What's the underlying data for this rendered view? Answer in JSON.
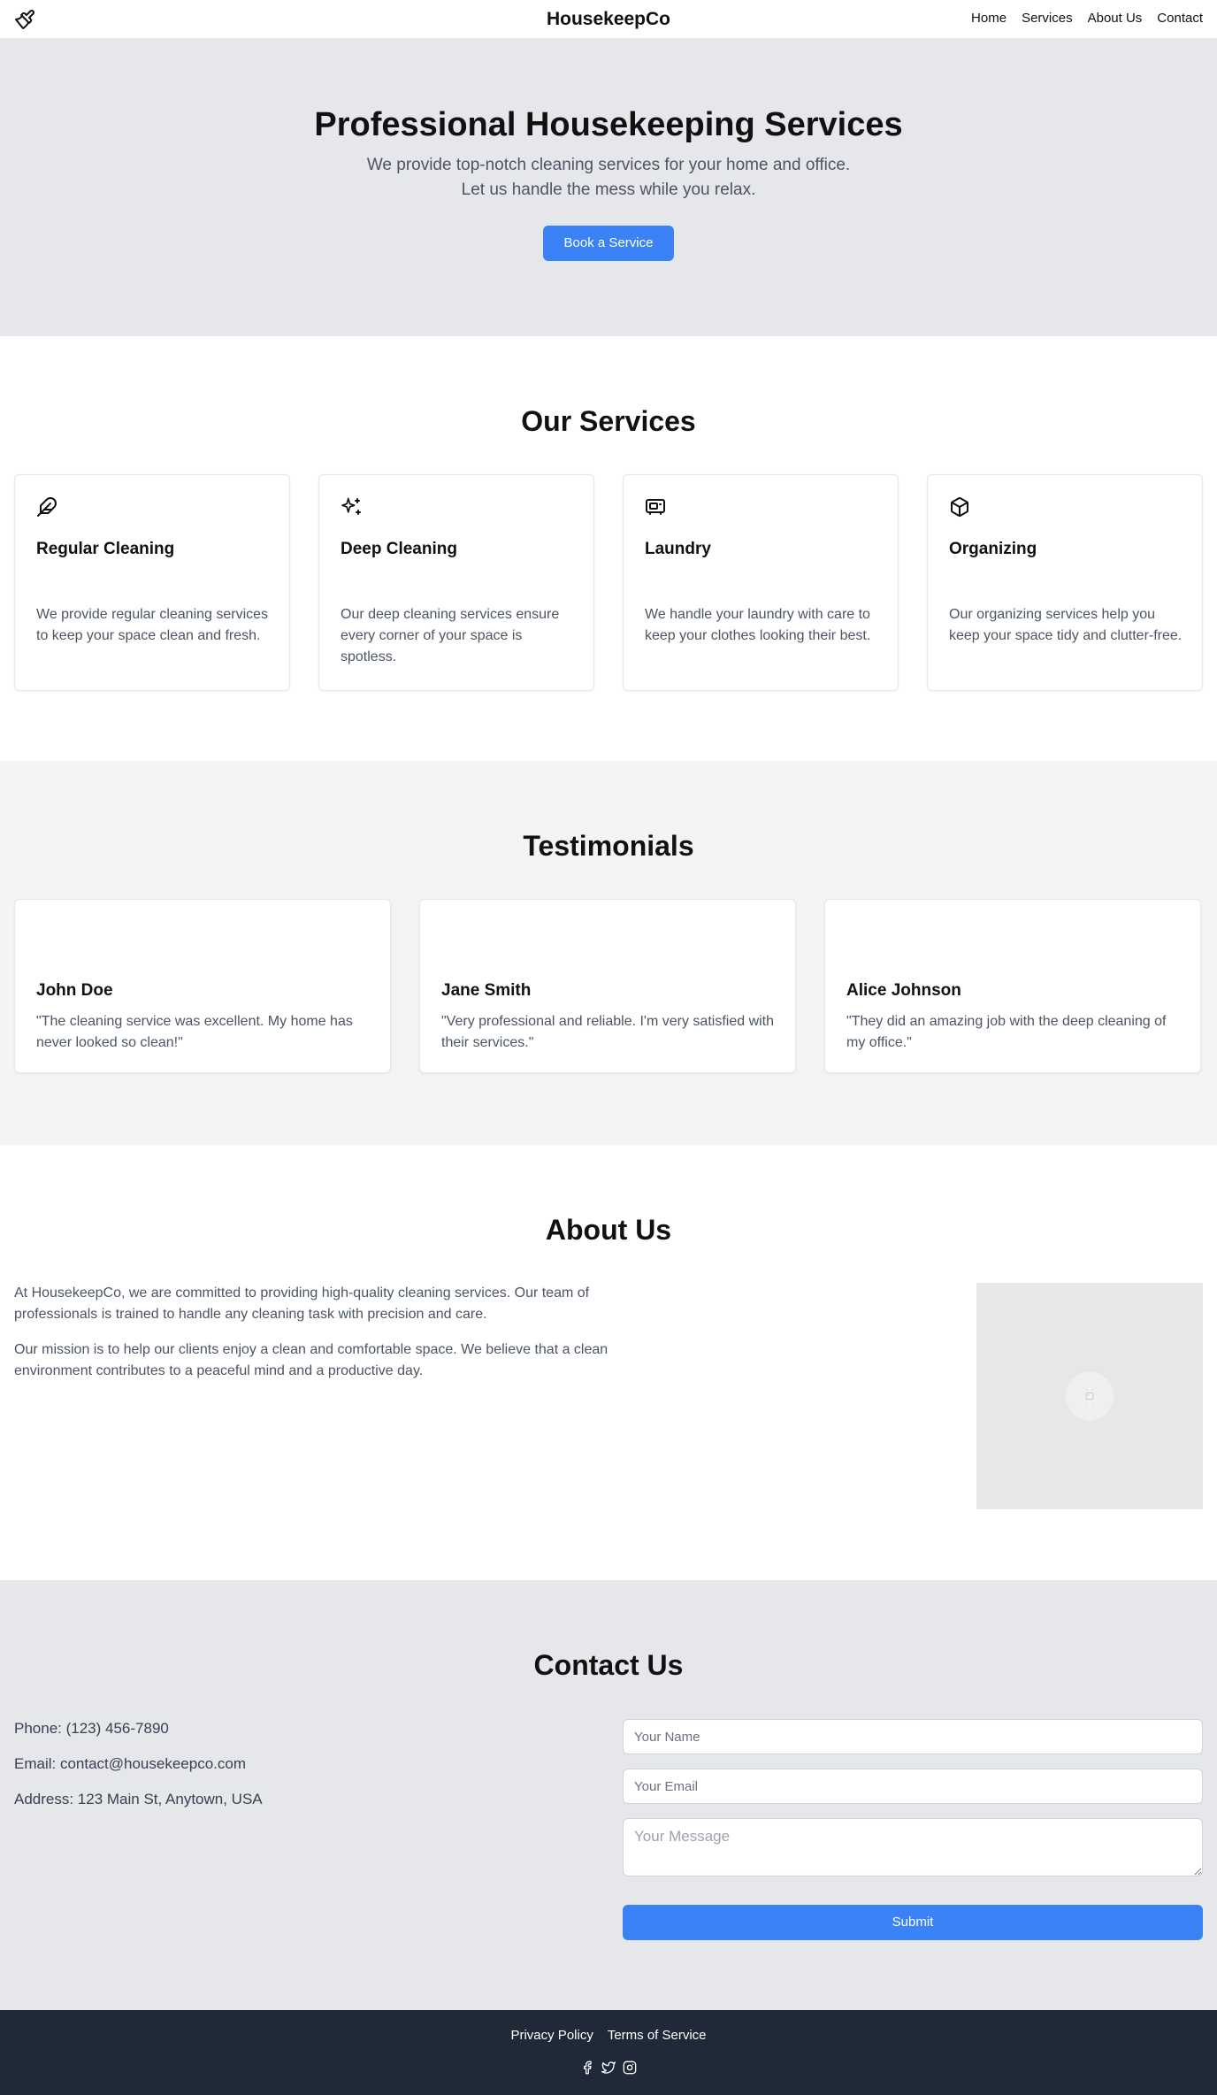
{
  "header": {
    "brand": "HousekeepCo",
    "nav": [
      "Home",
      "Services",
      "About Us",
      "Contact"
    ]
  },
  "hero": {
    "title": "Professional Housekeeping Services",
    "subtitle_line1": "We provide top-notch cleaning services for your home and office.",
    "subtitle_line2": "Let us handle the mess while you relax.",
    "cta": "Book a Service"
  },
  "services": {
    "title": "Our Services",
    "items": [
      {
        "icon": "feather-icon",
        "name": "Regular Cleaning",
        "desc": "We provide regular cleaning services to keep your space clean and fresh."
      },
      {
        "icon": "sparkles-icon",
        "name": "Deep Cleaning",
        "desc": "Our deep cleaning services ensure every corner of your space is spotless."
      },
      {
        "icon": "washer-icon",
        "name": "Laundry",
        "desc": "We handle your laundry with care to keep your clothes looking their best."
      },
      {
        "icon": "box-icon",
        "name": "Organizing",
        "desc": "Our organizing services help you keep your space tidy and clutter-free."
      }
    ]
  },
  "testimonials": {
    "title": "Testimonials",
    "items": [
      {
        "name": "John Doe",
        "quote": "\"The cleaning service was excellent. My home has never looked so clean!\""
      },
      {
        "name": "Jane Smith",
        "quote": "\"Very professional and reliable. I'm very satisfied with their services.\""
      },
      {
        "name": "Alice Johnson",
        "quote": "\"They did an amazing job with the deep cleaning of my office.\""
      }
    ]
  },
  "about": {
    "title": "About Us",
    "p1": "At HousekeepCo, we are committed to providing high-quality cleaning services. Our team of professionals is trained to handle any cleaning task with precision and care.",
    "p2": "Our mission is to help our clients enjoy a clean and comfortable space. We believe that a clean environment contributes to a peaceful mind and a productive day."
  },
  "contact": {
    "title": "Contact Us",
    "phone": "Phone: (123) 456-7890",
    "email": "Email: contact@housekeepco.com",
    "address": "Address: 123 Main St, Anytown, USA",
    "name_placeholder": "Your Name",
    "email_placeholder": "Your Email",
    "message_placeholder": "Your Message",
    "submit": "Submit"
  },
  "footer": {
    "links": [
      "Privacy Policy",
      "Terms of Service"
    ],
    "social": [
      "facebook-icon",
      "twitter-icon",
      "instagram-icon"
    ]
  },
  "colors": {
    "accent": "#3b82f6",
    "hero_bg": "#e5e7eb",
    "alt_bg": "#f3f4f6",
    "footer_bg": "#1f2937"
  }
}
